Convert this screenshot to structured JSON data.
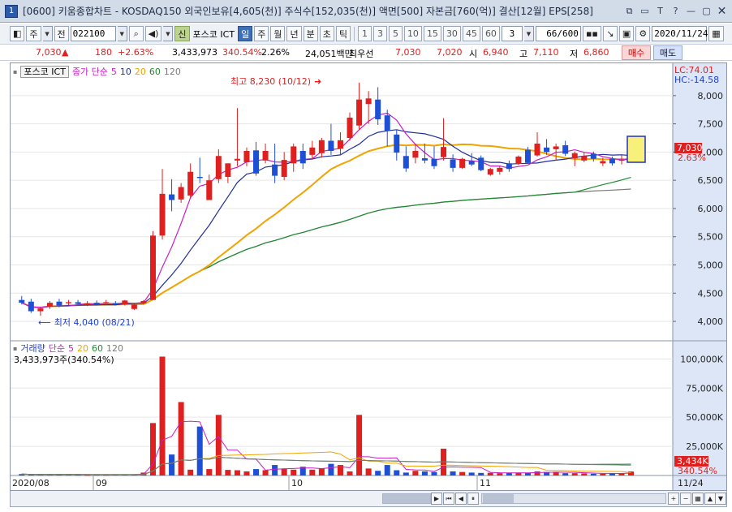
{
  "window": {
    "badge": "1",
    "title": "[0600] 키움종합차트 - KOSDAQ150 외국인보유[4,605(천)] 주식수[152,035(천)] 액면[500] 자본금[760(억)] 결산[12월] EPS[258]",
    "controls": [
      "⧉",
      "▭",
      "T",
      "?",
      "—",
      "▢",
      "✕"
    ]
  },
  "toolbar": {
    "period_week": "주",
    "prev": "전",
    "stock_code": "022100",
    "tag_new": "신",
    "stock_name": "포스코 ICT",
    "tab_day": "일",
    "tab_week": "주",
    "tab_month": "월",
    "tab_year": "년",
    "tab_minute": "분",
    "tab_second": "초",
    "tab_tick": "틱",
    "intervals": [
      "1",
      "3",
      "5",
      "10",
      "15",
      "30",
      "45",
      "60"
    ],
    "interval_value": "3",
    "count": "66/600",
    "date": "2020/11/24"
  },
  "quote": {
    "price": "7,030",
    "arrow": "▲",
    "change": "180",
    "change_pct": "+2.63%",
    "volume": "3,433,973",
    "volume_ratio": "340.54%",
    "turnover": "2.26%",
    "amount": "24,051백만",
    "best_label": "최우선",
    "best_ask": "7,030",
    "best_bid": "7,020",
    "open_label": "시",
    "open": "6,940",
    "high_label": "고",
    "high": "7,110",
    "low_label": "저",
    "low": "6,860",
    "buy_button": "매수",
    "sell_button": "매도"
  },
  "price_legend": {
    "name": "포스코 ICT",
    "series_prefix": "종가 단순",
    "ma": [
      "5",
      "10",
      "20",
      "60",
      "120"
    ],
    "ma_colors": [
      "#c71fc7",
      "#1e2f9a",
      "#f0a400",
      "#1e8a30",
      "#7a7a7a"
    ]
  },
  "volume_legend": {
    "title": "거래량",
    "series_prefix": "단순",
    "ma": [
      "5",
      "20",
      "60",
      "120"
    ],
    "value_text": "3,433,973주(340.54%)"
  },
  "right_info": {
    "lc": "LC:74.01",
    "hc": "HC:-14.58",
    "price_tag": "7,030",
    "price_pct": "2.63%",
    "vol_tag": "3,434K",
    "vol_pct": "340.54%"
  },
  "annotations": {
    "high": "최고 8,230 (10/12)",
    "low": "최저 4,040 (08/21)"
  },
  "x_labels": [
    "2020/08",
    "09",
    "10",
    "11",
    "11/24"
  ],
  "chart_data": {
    "type": "candlestick",
    "price_axis": {
      "ticks": [
        4000,
        4500,
        5000,
        5500,
        6000,
        6500,
        7000,
        7500,
        8000
      ],
      "labels": [
        "4,000",
        "4,500",
        "5,000",
        "5,500",
        "6,000",
        "6,500",
        "7,000",
        "7,500",
        "8,000"
      ],
      "range": [
        3800,
        8400
      ]
    },
    "volume_axis": {
      "ticks": [
        25000,
        50000,
        75000,
        100000
      ],
      "labels": [
        "25,000K",
        "50,000K",
        "75,000K",
        "100,000K"
      ],
      "range": [
        0,
        110000
      ]
    },
    "candles": [
      {
        "o": 4380,
        "h": 4450,
        "l": 4300,
        "c": 4330
      },
      {
        "o": 4350,
        "h": 4400,
        "l": 4150,
        "c": 4180
      },
      {
        "o": 4180,
        "h": 4250,
        "l": 4100,
        "c": 4230
      },
      {
        "o": 4260,
        "h": 4360,
        "l": 4220,
        "c": 4330
      },
      {
        "o": 4350,
        "h": 4400,
        "l": 4250,
        "c": 4280
      },
      {
        "o": 4320,
        "h": 4380,
        "l": 4290,
        "c": 4340
      },
      {
        "o": 4340,
        "h": 4380,
        "l": 4300,
        "c": 4310
      },
      {
        "o": 4300,
        "h": 4360,
        "l": 4270,
        "c": 4320
      },
      {
        "o": 4330,
        "h": 4370,
        "l": 4280,
        "c": 4300
      },
      {
        "o": 4330,
        "h": 4380,
        "l": 4290,
        "c": 4340
      },
      {
        "o": 4320,
        "h": 4360,
        "l": 4280,
        "c": 4300
      },
      {
        "o": 4300,
        "h": 4380,
        "l": 4280,
        "c": 4370
      },
      {
        "o": 4220,
        "h": 4320,
        "l": 4200,
        "c": 4300
      },
      {
        "o": 4320,
        "h": 4380,
        "l": 4300,
        "c": 4360
      },
      {
        "o": 4380,
        "h": 5600,
        "l": 4380,
        "c": 5520
      },
      {
        "o": 5520,
        "h": 6700,
        "l": 5450,
        "c": 6260
      },
      {
        "o": 6250,
        "h": 6520,
        "l": 5950,
        "c": 6150
      },
      {
        "o": 6160,
        "h": 6450,
        "l": 6100,
        "c": 6380
      },
      {
        "o": 6230,
        "h": 6800,
        "l": 6180,
        "c": 6650
      },
      {
        "o": 6560,
        "h": 6900,
        "l": 6450,
        "c": 6540
      },
      {
        "o": 6150,
        "h": 6600,
        "l": 6150,
        "c": 6500
      },
      {
        "o": 6520,
        "h": 7050,
        "l": 6450,
        "c": 6930
      },
      {
        "o": 6560,
        "h": 6800,
        "l": 6450,
        "c": 6800
      },
      {
        "o": 6850,
        "h": 7780,
        "l": 6750,
        "c": 6880
      },
      {
        "o": 6820,
        "h": 7080,
        "l": 6750,
        "c": 7020
      },
      {
        "o": 7030,
        "h": 7180,
        "l": 6580,
        "c": 6620
      },
      {
        "o": 6850,
        "h": 7150,
        "l": 6800,
        "c": 7020
      },
      {
        "o": 6780,
        "h": 7150,
        "l": 6450,
        "c": 6580
      },
      {
        "o": 6560,
        "h": 7000,
        "l": 6500,
        "c": 6860
      },
      {
        "o": 6800,
        "h": 7150,
        "l": 6650,
        "c": 7100
      },
      {
        "o": 7020,
        "h": 7150,
        "l": 6700,
        "c": 6800
      },
      {
        "o": 6950,
        "h": 7200,
        "l": 6880,
        "c": 7080
      },
      {
        "o": 6980,
        "h": 7250,
        "l": 6900,
        "c": 7210
      },
      {
        "o": 7200,
        "h": 7500,
        "l": 6950,
        "c": 7020
      },
      {
        "o": 7060,
        "h": 7350,
        "l": 6950,
        "c": 7210
      },
      {
        "o": 7250,
        "h": 7700,
        "l": 7200,
        "c": 7610
      },
      {
        "o": 7470,
        "h": 8230,
        "l": 7400,
        "c": 7930
      },
      {
        "o": 7850,
        "h": 8080,
        "l": 7500,
        "c": 7950
      },
      {
        "o": 7930,
        "h": 8150,
        "l": 7480,
        "c": 7580
      },
      {
        "o": 7650,
        "h": 7750,
        "l": 7100,
        "c": 7380
      },
      {
        "o": 7310,
        "h": 7400,
        "l": 6850,
        "c": 6990
      },
      {
        "o": 6930,
        "h": 7100,
        "l": 6650,
        "c": 6710
      },
      {
        "o": 6900,
        "h": 7150,
        "l": 6800,
        "c": 7020
      },
      {
        "o": 6890,
        "h": 7150,
        "l": 6800,
        "c": 6850
      },
      {
        "o": 6880,
        "h": 7100,
        "l": 6700,
        "c": 6750
      },
      {
        "o": 6910,
        "h": 7600,
        "l": 6850,
        "c": 7090
      },
      {
        "o": 6870,
        "h": 6960,
        "l": 6650,
        "c": 6720
      },
      {
        "o": 6720,
        "h": 6900,
        "l": 6700,
        "c": 6880
      },
      {
        "o": 6840,
        "h": 6980,
        "l": 6750,
        "c": 6780
      },
      {
        "o": 6900,
        "h": 6940,
        "l": 6660,
        "c": 6680
      },
      {
        "o": 6600,
        "h": 6720,
        "l": 6580,
        "c": 6700
      },
      {
        "o": 6650,
        "h": 6760,
        "l": 6600,
        "c": 6720
      },
      {
        "o": 6800,
        "h": 6850,
        "l": 6650,
        "c": 6700
      },
      {
        "o": 6790,
        "h": 6940,
        "l": 6770,
        "c": 6920
      },
      {
        "o": 7040,
        "h": 7090,
        "l": 6800,
        "c": 6810
      },
      {
        "o": 6940,
        "h": 7350,
        "l": 6920,
        "c": 7150
      },
      {
        "o": 7080,
        "h": 7230,
        "l": 6950,
        "c": 7000
      },
      {
        "o": 7050,
        "h": 7150,
        "l": 6850,
        "c": 7100
      },
      {
        "o": 7120,
        "h": 7200,
        "l": 6930,
        "c": 6970
      },
      {
        "o": 6890,
        "h": 7010,
        "l": 6750,
        "c": 6980
      },
      {
        "o": 6850,
        "h": 7000,
        "l": 6820,
        "c": 6930
      },
      {
        "o": 6970,
        "h": 7010,
        "l": 6830,
        "c": 6880
      },
      {
        "o": 6800,
        "h": 6900,
        "l": 6750,
        "c": 6840
      },
      {
        "o": 6880,
        "h": 6920,
        "l": 6760,
        "c": 6800
      },
      {
        "o": 6860,
        "h": 6940,
        "l": 6780,
        "c": 6860
      },
      {
        "o": 6940,
        "h": 7110,
        "l": 6860,
        "c": 7030
      }
    ],
    "volumes": [
      1200,
      800,
      700,
      900,
      1000,
      700,
      600,
      500,
      700,
      600,
      800,
      900,
      700,
      2500,
      45000,
      102000,
      18000,
      63000,
      5000,
      42000,
      5500,
      52000,
      4800,
      4500,
      3500,
      5500,
      4500,
      9000,
      6000,
      5000,
      7500,
      5000,
      6000,
      10000,
      9000,
      3500,
      52000,
      6000,
      4000,
      9000,
      4500,
      2500,
      4000,
      3500,
      3000,
      23000,
      3500,
      3000,
      2500,
      2200,
      2300,
      2000,
      2300,
      2500,
      2200,
      3500,
      3000,
      3200,
      2000,
      2000,
      1800,
      1500,
      1600,
      2000,
      1800,
      3434
    ]
  }
}
